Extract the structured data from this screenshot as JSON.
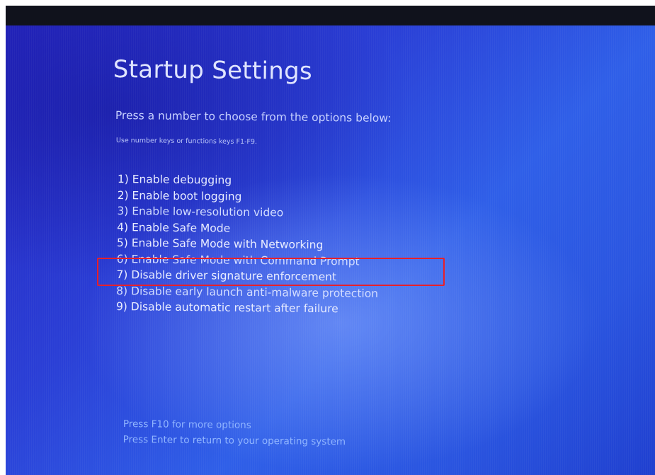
{
  "screen": {
    "title": "Startup Settings",
    "subtitle": "Press a number to choose from the options below:",
    "hint": "Use number keys or functions keys F1-F9.",
    "options": [
      {
        "label": "1) Enable debugging"
      },
      {
        "label": "2) Enable boot logging"
      },
      {
        "label": "3) Enable low-resolution video"
      },
      {
        "label": "4) Enable Safe Mode"
      },
      {
        "label": "5) Enable Safe Mode with Networking"
      },
      {
        "label": "6) Enable Safe Mode with Command Prompt"
      },
      {
        "label": "7) Disable driver signature enforcement"
      },
      {
        "label": "8) Disable early launch anti-malware protection"
      },
      {
        "label": "9) Disable automatic restart after failure"
      }
    ],
    "highlighted_option": "7) Disable driver signature enforcement",
    "footer": {
      "more_options": "Press F10 for more options",
      "return": "Press Enter to return to your operating system"
    }
  },
  "colors": {
    "background": "#2a45d8",
    "text": "#e8ecff",
    "footer_text": "#8fb4ff",
    "highlight_border": "#e8202a"
  }
}
